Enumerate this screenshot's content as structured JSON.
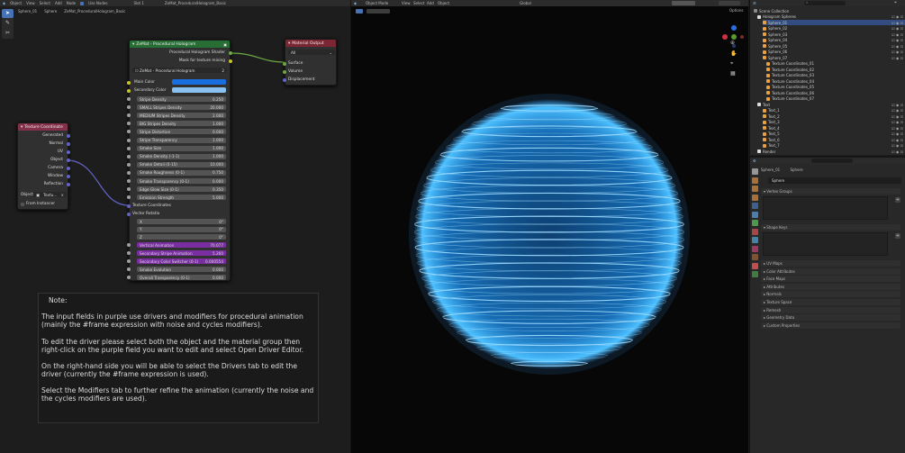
{
  "node_editor": {
    "header": {
      "menu": [
        "Object",
        "View",
        "Select",
        "Add",
        "Node"
      ],
      "use_nodes_label": "Use Nodes",
      "slot": "Slot 1",
      "material": "ZeMat_ProceduralHologram_Basic"
    },
    "breadcrumb": [
      "Sphere_01",
      "Sphere",
      "ZeMat_ProceduralHologram_Basic"
    ],
    "group_node": {
      "title": "ZeMat - Procedural Hologram",
      "outputs": [
        "Procedural Hologram Shader",
        "Mask for texture mixing"
      ],
      "group_selector": "ZeMat - Procedural Hologram",
      "user_count": "2",
      "main_color_label": "Main Color",
      "secondary_color_label": "Secondary Color",
      "colors": {
        "main": "#1a6fe0",
        "secondary": "#88c0ef"
      },
      "fields": [
        {
          "label": "Stripe Density",
          "value": "0.250",
          "purple": false
        },
        {
          "label": "SMALL Stripes Density",
          "value": "20.000",
          "purple": false
        },
        {
          "label": "MEDIUM Stripes Density",
          "value": "2.000",
          "purple": false
        },
        {
          "label": "BIG Stripes Density",
          "value": "1.000",
          "purple": false
        },
        {
          "label": "Stripe Distortion",
          "value": "0.000",
          "purple": false
        },
        {
          "label": "Stripe Transparency",
          "value": "1.000",
          "purple": false
        },
        {
          "label": "Smoke Size",
          "value": "1.000",
          "purple": false
        },
        {
          "label": "Smoke Density (-1-1)",
          "value": "1.000",
          "purple": false
        },
        {
          "label": "Smoke Detail (0-15)",
          "value": "10.000",
          "purple": false
        },
        {
          "label": "Smoke Roughness (0-1)",
          "value": "0.750",
          "purple": false
        },
        {
          "label": "Smoke Transparency (0-1)",
          "value": "0.000",
          "purple": false
        },
        {
          "label": "Edge Glow Size (0-1)",
          "value": "0.350",
          "purple": false
        },
        {
          "label": "Emission Strength",
          "value": "5.000",
          "purple": false
        }
      ],
      "texture_coordinates_label": "Texture Coordinates",
      "vector_rotation": {
        "label": "Vector Rotatio",
        "axes": [
          {
            "axis": "X",
            "value": "0°"
          },
          {
            "axis": "Y",
            "value": "0°"
          },
          {
            "axis": "Z",
            "value": "0°"
          }
        ]
      },
      "animated_fields": [
        {
          "label": "Vertical Animation",
          "value": "70.077",
          "purple": true
        },
        {
          "label": "Secondary Stripe Animation",
          "value": "5.260",
          "purple": true
        },
        {
          "label": "Secondary Color Switcher (0-1)",
          "value": "0.000554",
          "purple": true
        },
        {
          "label": "Smoke Evolution",
          "value": "0.000",
          "purple": false
        },
        {
          "label": "Overall Transparency (0-1)",
          "value": "0.000",
          "purple": false
        }
      ]
    },
    "output_node": {
      "title": "Material Output",
      "target": "All",
      "inputs": [
        "Surface",
        "Volume",
        "Displacement"
      ]
    },
    "texcoord_node": {
      "title": "Texture Coordinate",
      "outputs": [
        "Generated",
        "Normal",
        "UV",
        "Object",
        "Camera",
        "Window",
        "Reflection"
      ],
      "object_label": "Object:",
      "object_value": "Textu...",
      "from_instancer": "From Instancer"
    },
    "note": {
      "title": "Note:",
      "paragraphs": [
        "The input fields in purple use drivers and modifiers for procedural animation (mainly the #frame expression with noise and cycles modifiers).",
        "To edit the driver please select both the object and the material group then right-click on the purple field you want to edit and select Open Driver Editor.",
        "On the right-hand side you will be able to select the Drivers tab to edit the driver (currently the #frame expression is used).",
        "Select the Modifiers tab to further refine the animation (currently the noise and the cycles modifiers are used)."
      ]
    }
  },
  "viewport": {
    "mode": "Object Mode",
    "menu": [
      "View",
      "Select",
      "Add",
      "Object"
    ],
    "transform": "Global",
    "options": "Options",
    "sphere_color": "#3aa7ff"
  },
  "outliner": {
    "title": "Scene Collection",
    "collection": "Hologram Spheres",
    "spheres": [
      "Sphere_01",
      "Sphere_02",
      "Sphere_03",
      "Sphere_04",
      "Sphere_05",
      "Sphere_06",
      "Sphere_07"
    ],
    "texcoords": [
      "Texture Coordinates_01",
      "Texture Coordinates_02",
      "Texture Coordinates_03",
      "Texture Coordinates_04",
      "Texture Coordinates_05",
      "Texture Coordinates_06",
      "Texture Coordinates_07"
    ],
    "text_collection": "Text",
    "texts": [
      "Text_1",
      "Text_2",
      "Text_3",
      "Text_4",
      "Text_5",
      "Text_6",
      "Text_7"
    ],
    "render": "Render"
  },
  "properties": {
    "breadcrumb": [
      "Sphere_01",
      "Sphere"
    ],
    "mesh_name": "Sphere",
    "panels_open": [
      "Vertex Groups",
      "Shape Keys"
    ],
    "panels": [
      "UV Maps",
      "Color Attributes",
      "Face Maps",
      "Attributes",
      "Normals",
      "Texture Space",
      "Remesh",
      "Geometry Data",
      "Custom Properties"
    ]
  }
}
